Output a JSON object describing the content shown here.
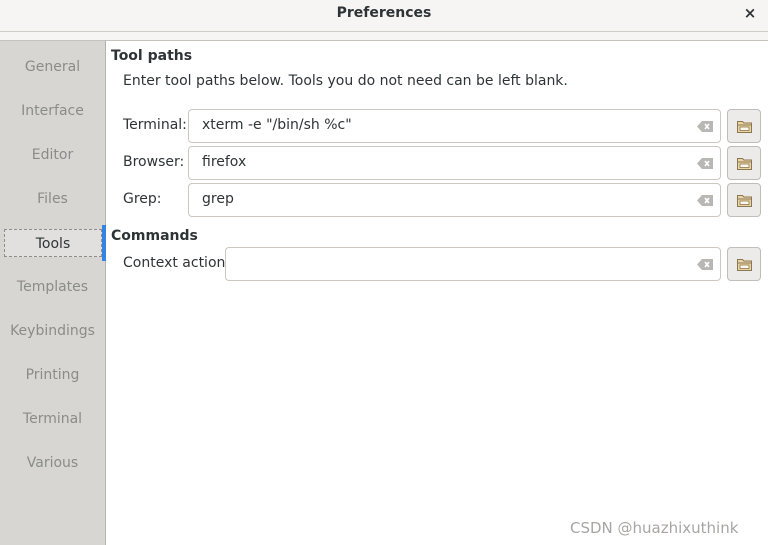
{
  "window": {
    "title": "Preferences",
    "close_glyph": "×"
  },
  "sidebar": {
    "tabs": [
      {
        "label": "General"
      },
      {
        "label": "Interface"
      },
      {
        "label": "Editor"
      },
      {
        "label": "Files"
      },
      {
        "label": "Tools"
      },
      {
        "label": "Templates"
      },
      {
        "label": "Keybindings"
      },
      {
        "label": "Printing"
      },
      {
        "label": "Terminal"
      },
      {
        "label": "Various"
      }
    ],
    "active_tab": "Tools",
    "accent_color": "#3584e4"
  },
  "tool_paths": {
    "heading": "Tool paths",
    "description": "Enter tool paths below. Tools you do not need can be left blank.",
    "terminal": {
      "label": "Terminal:",
      "value": "xterm -e \"/bin/sh %c\""
    },
    "browser": {
      "label": "Browser:",
      "value": "firefox"
    },
    "grep": {
      "label": "Grep:",
      "value": "grep"
    }
  },
  "commands": {
    "heading": "Commands",
    "context_action": {
      "label": "Context action:",
      "value": ""
    }
  },
  "icons": {
    "clear": "clear-entry-icon",
    "browse": "folder-icon"
  },
  "watermark": "CSDN @huazhixuthink"
}
